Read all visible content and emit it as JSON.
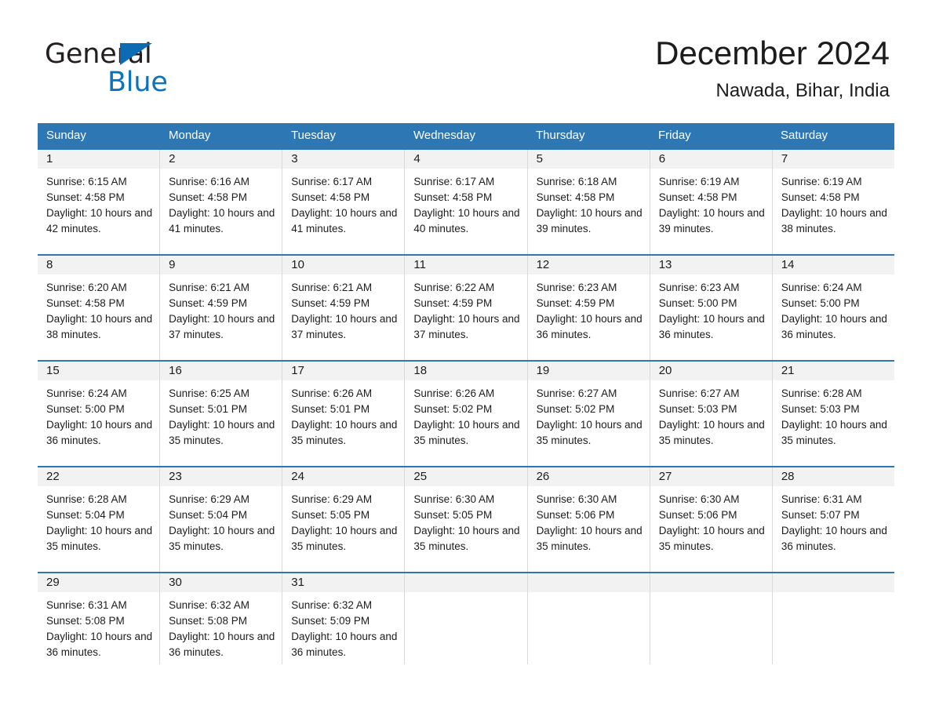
{
  "brand": {
    "name_part1": "General",
    "name_part2": "Blue",
    "triangle_color": "#0b6cb3",
    "blue_text_color": "#0b72bd"
  },
  "header": {
    "title": "December 2024",
    "subtitle": "Nawada, Bihar, India"
  },
  "theme": {
    "header_blue": "#2e77b5",
    "daynum_band": "#f2f2f2",
    "grid_line": "#d9d9d9",
    "text": "#1c1c1c"
  },
  "calendar": {
    "day_headers": [
      "Sunday",
      "Monday",
      "Tuesday",
      "Wednesday",
      "Thursday",
      "Friday",
      "Saturday"
    ],
    "weeks": [
      [
        {
          "day": "1",
          "sunrise": "Sunrise: 6:15 AM",
          "sunset": "Sunset: 4:58 PM",
          "daylight": "Daylight: 10 hours and 42 minutes."
        },
        {
          "day": "2",
          "sunrise": "Sunrise: 6:16 AM",
          "sunset": "Sunset: 4:58 PM",
          "daylight": "Daylight: 10 hours and 41 minutes."
        },
        {
          "day": "3",
          "sunrise": "Sunrise: 6:17 AM",
          "sunset": "Sunset: 4:58 PM",
          "daylight": "Daylight: 10 hours and 41 minutes."
        },
        {
          "day": "4",
          "sunrise": "Sunrise: 6:17 AM",
          "sunset": "Sunset: 4:58 PM",
          "daylight": "Daylight: 10 hours and 40 minutes."
        },
        {
          "day": "5",
          "sunrise": "Sunrise: 6:18 AM",
          "sunset": "Sunset: 4:58 PM",
          "daylight": "Daylight: 10 hours and 39 minutes."
        },
        {
          "day": "6",
          "sunrise": "Sunrise: 6:19 AM",
          "sunset": "Sunset: 4:58 PM",
          "daylight": "Daylight: 10 hours and 39 minutes."
        },
        {
          "day": "7",
          "sunrise": "Sunrise: 6:19 AM",
          "sunset": "Sunset: 4:58 PM",
          "daylight": "Daylight: 10 hours and 38 minutes."
        }
      ],
      [
        {
          "day": "8",
          "sunrise": "Sunrise: 6:20 AM",
          "sunset": "Sunset: 4:58 PM",
          "daylight": "Daylight: 10 hours and 38 minutes."
        },
        {
          "day": "9",
          "sunrise": "Sunrise: 6:21 AM",
          "sunset": "Sunset: 4:59 PM",
          "daylight": "Daylight: 10 hours and 37 minutes."
        },
        {
          "day": "10",
          "sunrise": "Sunrise: 6:21 AM",
          "sunset": "Sunset: 4:59 PM",
          "daylight": "Daylight: 10 hours and 37 minutes."
        },
        {
          "day": "11",
          "sunrise": "Sunrise: 6:22 AM",
          "sunset": "Sunset: 4:59 PM",
          "daylight": "Daylight: 10 hours and 37 minutes."
        },
        {
          "day": "12",
          "sunrise": "Sunrise: 6:23 AM",
          "sunset": "Sunset: 4:59 PM",
          "daylight": "Daylight: 10 hours and 36 minutes."
        },
        {
          "day": "13",
          "sunrise": "Sunrise: 6:23 AM",
          "sunset": "Sunset: 5:00 PM",
          "daylight": "Daylight: 10 hours and 36 minutes."
        },
        {
          "day": "14",
          "sunrise": "Sunrise: 6:24 AM",
          "sunset": "Sunset: 5:00 PM",
          "daylight": "Daylight: 10 hours and 36 minutes."
        }
      ],
      [
        {
          "day": "15",
          "sunrise": "Sunrise: 6:24 AM",
          "sunset": "Sunset: 5:00 PM",
          "daylight": "Daylight: 10 hours and 36 minutes."
        },
        {
          "day": "16",
          "sunrise": "Sunrise: 6:25 AM",
          "sunset": "Sunset: 5:01 PM",
          "daylight": "Daylight: 10 hours and 35 minutes."
        },
        {
          "day": "17",
          "sunrise": "Sunrise: 6:26 AM",
          "sunset": "Sunset: 5:01 PM",
          "daylight": "Daylight: 10 hours and 35 minutes."
        },
        {
          "day": "18",
          "sunrise": "Sunrise: 6:26 AM",
          "sunset": "Sunset: 5:02 PM",
          "daylight": "Daylight: 10 hours and 35 minutes."
        },
        {
          "day": "19",
          "sunrise": "Sunrise: 6:27 AM",
          "sunset": "Sunset: 5:02 PM",
          "daylight": "Daylight: 10 hours and 35 minutes."
        },
        {
          "day": "20",
          "sunrise": "Sunrise: 6:27 AM",
          "sunset": "Sunset: 5:03 PM",
          "daylight": "Daylight: 10 hours and 35 minutes."
        },
        {
          "day": "21",
          "sunrise": "Sunrise: 6:28 AM",
          "sunset": "Sunset: 5:03 PM",
          "daylight": "Daylight: 10 hours and 35 minutes."
        }
      ],
      [
        {
          "day": "22",
          "sunrise": "Sunrise: 6:28 AM",
          "sunset": "Sunset: 5:04 PM",
          "daylight": "Daylight: 10 hours and 35 minutes."
        },
        {
          "day": "23",
          "sunrise": "Sunrise: 6:29 AM",
          "sunset": "Sunset: 5:04 PM",
          "daylight": "Daylight: 10 hours and 35 minutes."
        },
        {
          "day": "24",
          "sunrise": "Sunrise: 6:29 AM",
          "sunset": "Sunset: 5:05 PM",
          "daylight": "Daylight: 10 hours and 35 minutes."
        },
        {
          "day": "25",
          "sunrise": "Sunrise: 6:30 AM",
          "sunset": "Sunset: 5:05 PM",
          "daylight": "Daylight: 10 hours and 35 minutes."
        },
        {
          "day": "26",
          "sunrise": "Sunrise: 6:30 AM",
          "sunset": "Sunset: 5:06 PM",
          "daylight": "Daylight: 10 hours and 35 minutes."
        },
        {
          "day": "27",
          "sunrise": "Sunrise: 6:30 AM",
          "sunset": "Sunset: 5:06 PM",
          "daylight": "Daylight: 10 hours and 35 minutes."
        },
        {
          "day": "28",
          "sunrise": "Sunrise: 6:31 AM",
          "sunset": "Sunset: 5:07 PM",
          "daylight": "Daylight: 10 hours and 36 minutes."
        }
      ],
      [
        {
          "day": "29",
          "sunrise": "Sunrise: 6:31 AM",
          "sunset": "Sunset: 5:08 PM",
          "daylight": "Daylight: 10 hours and 36 minutes."
        },
        {
          "day": "30",
          "sunrise": "Sunrise: 6:32 AM",
          "sunset": "Sunset: 5:08 PM",
          "daylight": "Daylight: 10 hours and 36 minutes."
        },
        {
          "day": "31",
          "sunrise": "Sunrise: 6:32 AM",
          "sunset": "Sunset: 5:09 PM",
          "daylight": "Daylight: 10 hours and 36 minutes."
        },
        {
          "day": "",
          "sunrise": "",
          "sunset": "",
          "daylight": ""
        },
        {
          "day": "",
          "sunrise": "",
          "sunset": "",
          "daylight": ""
        },
        {
          "day": "",
          "sunrise": "",
          "sunset": "",
          "daylight": ""
        },
        {
          "day": "",
          "sunrise": "",
          "sunset": "",
          "daylight": ""
        }
      ]
    ]
  }
}
